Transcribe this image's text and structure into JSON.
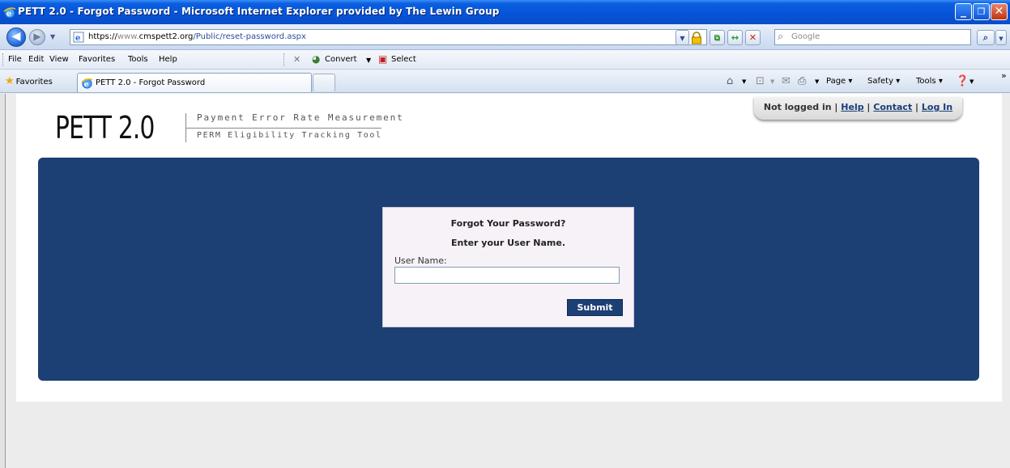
{
  "window": {
    "title": "PETT 2.0 - Forgot Password - Microsoft Internet Explorer provided by The Lewin Group"
  },
  "address": {
    "url_prefix": "https://",
    "url_www": "www.",
    "url_domain": "cmspett2.org",
    "url_path": "/Public/reset-password.aspx",
    "search_placeholder": "Google"
  },
  "menu": {
    "items": [
      "File",
      "Edit",
      "View",
      "Favorites",
      "Tools",
      "Help"
    ],
    "convert_label": "Convert",
    "select_label": "Select"
  },
  "favbar": {
    "favorites_label": "Favorites",
    "tab_label": "PETT 2.0 - Forgot Password",
    "page_label": "Page",
    "safety_label": "Safety",
    "tools_label": "Tools"
  },
  "header": {
    "logo_main": "PETT 2.0",
    "logo_line1": "Payment Error Rate Measurement",
    "logo_line2": "PERM Eligibility Tracking Tool",
    "status_text": "Not logged in",
    "help_link": "Help",
    "contact_link": "Contact",
    "login_link": "Log In"
  },
  "form": {
    "heading": "Forgot Your Password?",
    "subheading": "Enter your User Name.",
    "username_label": "User Name:",
    "username_value": "",
    "submit_label": "Submit"
  },
  "colors": {
    "panel_blue": "#1c3f74",
    "title_blue": "#0553d8"
  }
}
